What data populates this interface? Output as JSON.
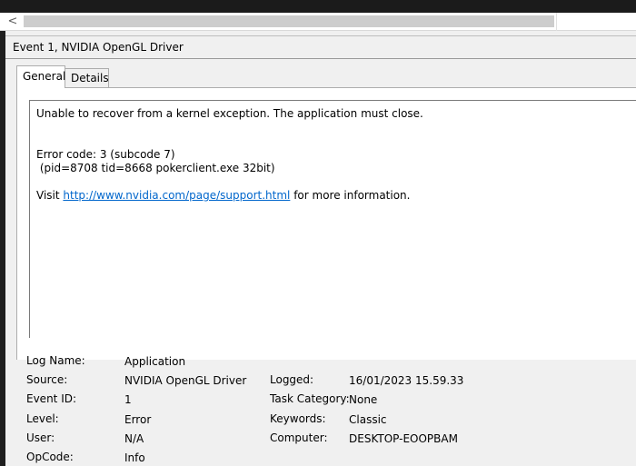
{
  "window": {
    "scroll_left_arrow": "<"
  },
  "event": {
    "title": "Event 1, NVIDIA OpenGL Driver",
    "tabs": [
      "General",
      "Details"
    ],
    "message": {
      "line1": "Unable to recover from a kernel exception. The application must close.",
      "line2": "Error code: 3 (subcode 7)",
      "line3": " (pid=8708 tid=8668 pokerclient.exe 32bit)",
      "visit_prefix": "Visit ",
      "link": "http://www.nvidia.com/page/support.html",
      "visit_suffix": " for more information."
    },
    "fields": {
      "log_name_label": "Log Name:",
      "log_name": "Application",
      "source_label": "Source:",
      "source": "NVIDIA OpenGL Driver",
      "logged_label": "Logged:",
      "logged": "16/01/2023 15.59.33",
      "event_id_label": "Event ID:",
      "event_id": "1",
      "task_category_label": "Task Category:",
      "task_category": "None",
      "level_label": "Level:",
      "level": "Error",
      "keywords_label": "Keywords:",
      "keywords": "Classic",
      "user_label": "User:",
      "user": "N/A",
      "computer_label": "Computer:",
      "computer": "DESKTOP-EOOPBAM",
      "opcode_label": "OpCode:",
      "opcode": "Info"
    }
  }
}
